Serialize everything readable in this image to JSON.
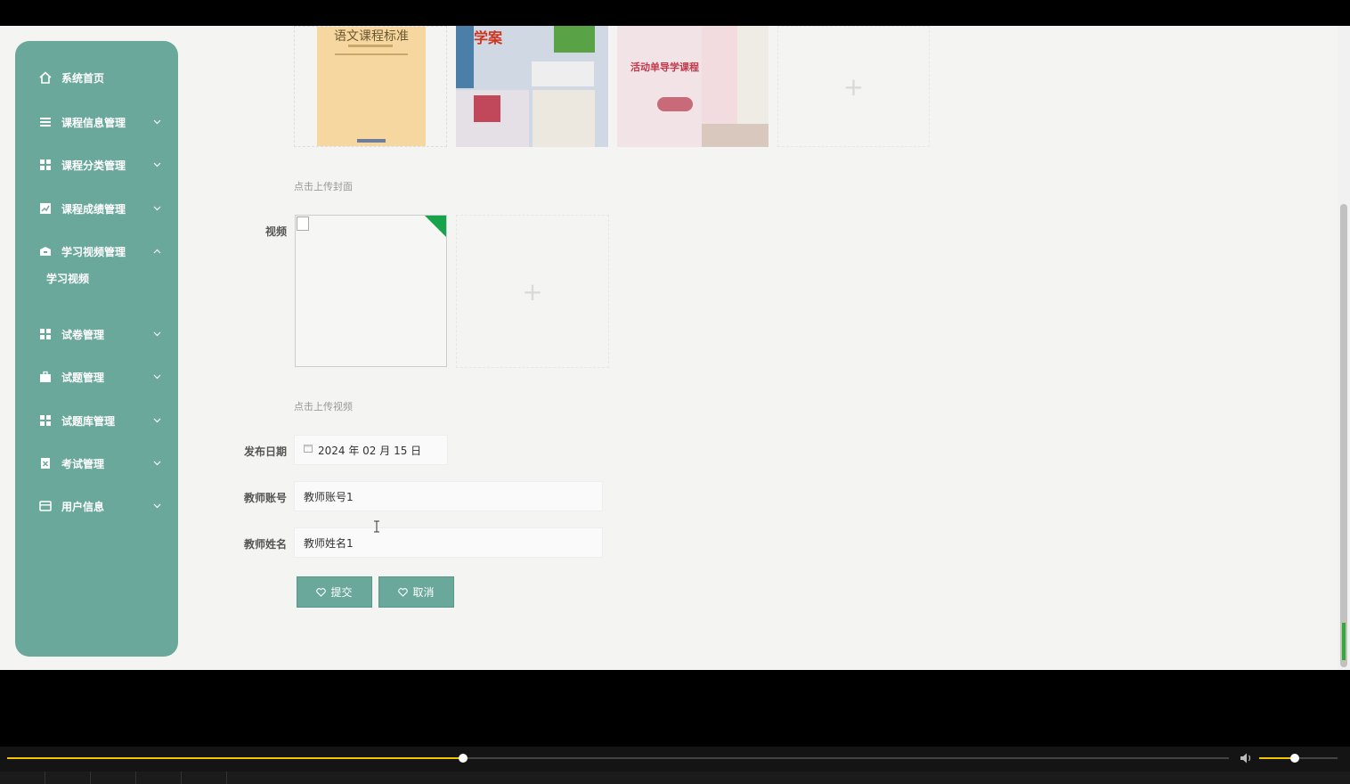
{
  "sidebar": {
    "items": [
      {
        "label": "系统首页",
        "icon": "home-icon",
        "chevron": ""
      },
      {
        "label": "课程信息管理",
        "icon": "list-icon",
        "chevron": "down"
      },
      {
        "label": "课程分类管理",
        "icon": "grid-icon",
        "chevron": "down"
      },
      {
        "label": "课程成绩管理",
        "icon": "chart-icon",
        "chevron": "down"
      },
      {
        "label": "学习视频管理",
        "icon": "box-icon",
        "chevron": "up"
      },
      {
        "label": "试卷管理",
        "icon": "grid-icon",
        "chevron": "down"
      },
      {
        "label": "试题管理",
        "icon": "briefcase-icon",
        "chevron": "down"
      },
      {
        "label": "试题库管理",
        "icon": "grid-icon",
        "chevron": "down"
      },
      {
        "label": "考试管理",
        "icon": "clipboard-icon",
        "chevron": "down"
      },
      {
        "label": "用户信息",
        "icon": "card-icon",
        "chevron": "down"
      }
    ],
    "sub_items": [
      {
        "label": "学习视频"
      }
    ]
  },
  "form": {
    "cover_hint": "点击上传封面",
    "video_label": "视频",
    "video_hint": "点击上传视频",
    "date_label": "发布日期",
    "date_value": "2024 年 02 月 15 日",
    "teacher_account_label": "教师账号",
    "teacher_account_value": "教师账号1",
    "teacher_name_label": "教师姓名",
    "teacher_name_value": "教师姓名1",
    "submit_label": "提交",
    "cancel_label": "取消"
  },
  "covers": [
    {
      "title": "语文课程标准",
      "color": "#f6d7a0"
    },
    {
      "title": "学案",
      "color": "#cfd8e3"
    },
    {
      "title": "活动单导学课程",
      "color": "#f2e4e6"
    }
  ],
  "player": {
    "progress": 0.373,
    "volume": 0.45
  },
  "colors": {
    "accent": "#6aa89c",
    "progress": "#f5c400"
  }
}
